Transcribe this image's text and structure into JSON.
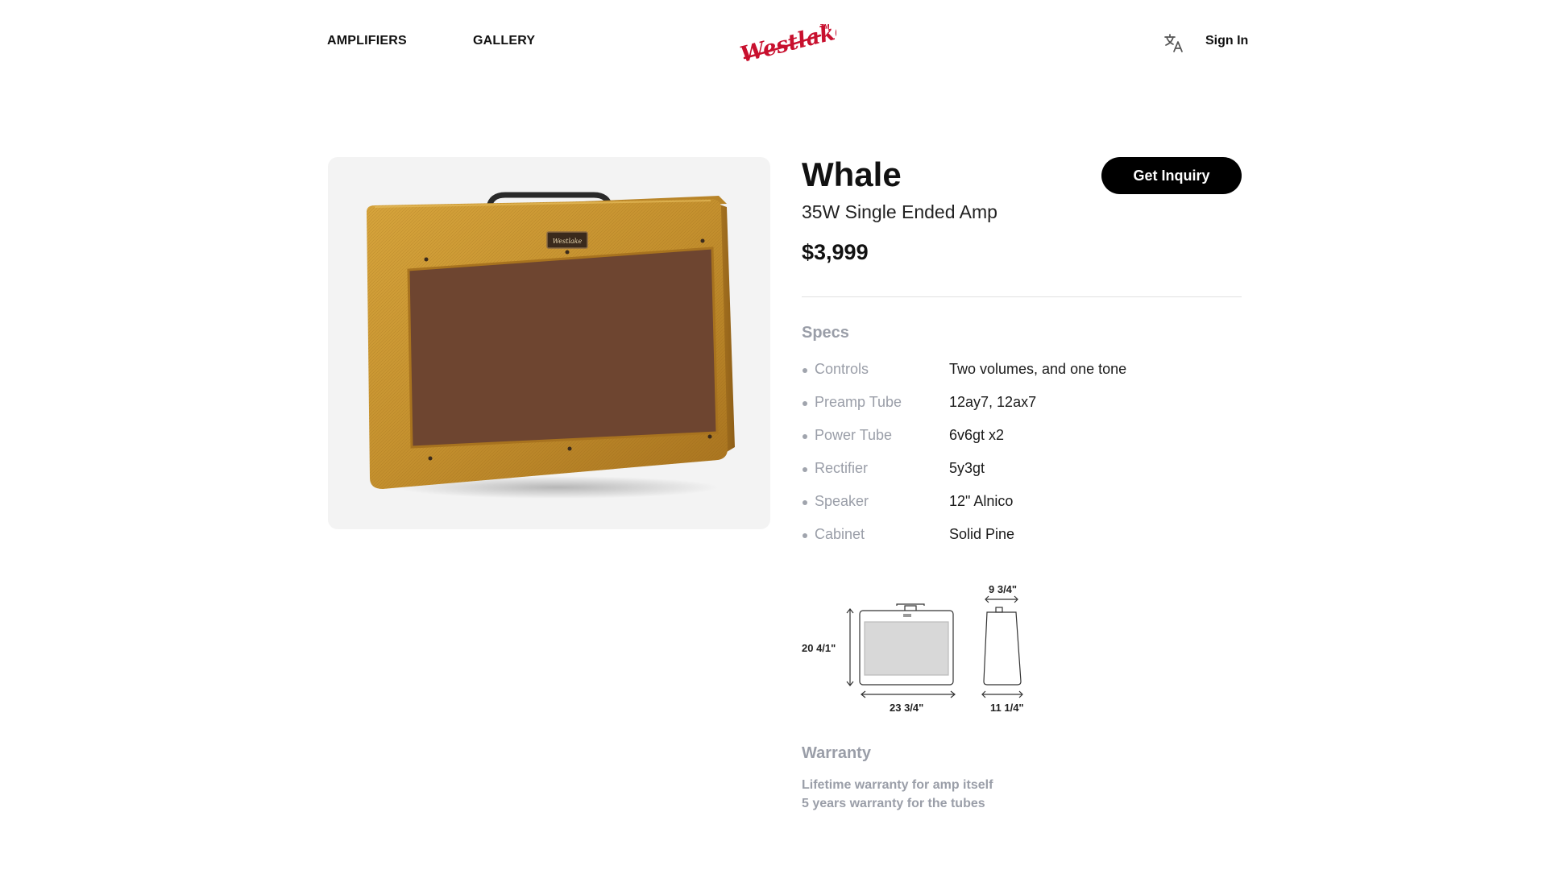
{
  "nav": {
    "amplifiers": "AMPLIFIERS",
    "gallery": "GALLERY",
    "brand": "Westlake",
    "brand_mark": "TM",
    "language_icon": "translate-icon",
    "sign_in": "Sign In"
  },
  "product": {
    "name": "Whale",
    "subtitle": "35W Single Ended Amp",
    "price": "$3,999",
    "inquiry_button": "Get Inquiry",
    "badge_text": "Westlake"
  },
  "specs": {
    "heading": "Specs",
    "items": [
      {
        "label": "Controls",
        "value": "Two volumes, and one tone"
      },
      {
        "label": "Preamp Tube",
        "value": "12ay7, 12ax7"
      },
      {
        "label": "Power Tube",
        "value": "6v6gt x2"
      },
      {
        "label": "Rectifier",
        "value": "5y3gt"
      },
      {
        "label": "Speaker",
        "value": "12\" Alnico"
      },
      {
        "label": "Cabinet",
        "value": "Solid Pine"
      }
    ]
  },
  "dimensions": {
    "height": "20 4/1\"",
    "width": "23 3/4\"",
    "depth_top": "9 3/4\"",
    "depth_bottom": "11 1/4\""
  },
  "warranty": {
    "heading": "Warranty",
    "lines": [
      "Lifetime warranty for amp itself",
      "5 years warranty for the tubes"
    ]
  },
  "colors": {
    "accent_red": "#c8102e",
    "muted_gray": "#9a9ea8",
    "tweed": "#c9952f",
    "grill": "#6e4530"
  }
}
